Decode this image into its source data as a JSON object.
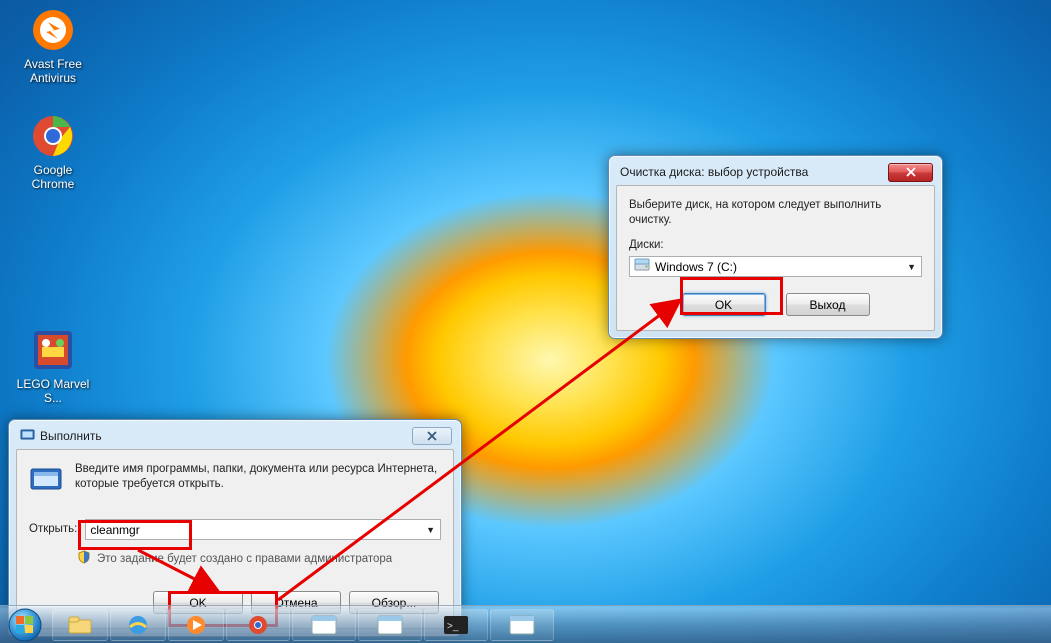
{
  "desktop": {
    "icons": [
      {
        "id": "avast",
        "label": "Avast Free\nAntivirus"
      },
      {
        "id": "chrome",
        "label": "Google\nChrome"
      },
      {
        "id": "lego",
        "label": "LEGO Marvel\nS..."
      }
    ]
  },
  "run_dialog": {
    "title": "Выполнить",
    "instruction": "Введите имя программы, папки, документа или ресурса Интернета, которые требуется открыть.",
    "open_label": "Открыть:",
    "open_value": "cleanmgr",
    "admin_note": "Это задание будет создано с правами администратора",
    "ok": "OK",
    "cancel": "Отмена",
    "browse": "Обзор..."
  },
  "cleanup_dialog": {
    "title": "Очистка диска: выбор устройства",
    "instruction": "Выберите диск, на котором следует выполнить очистку.",
    "drives_label": "Диски:",
    "drive_value": "Windows 7 (C:)",
    "ok": "OK",
    "exit": "Выход"
  }
}
